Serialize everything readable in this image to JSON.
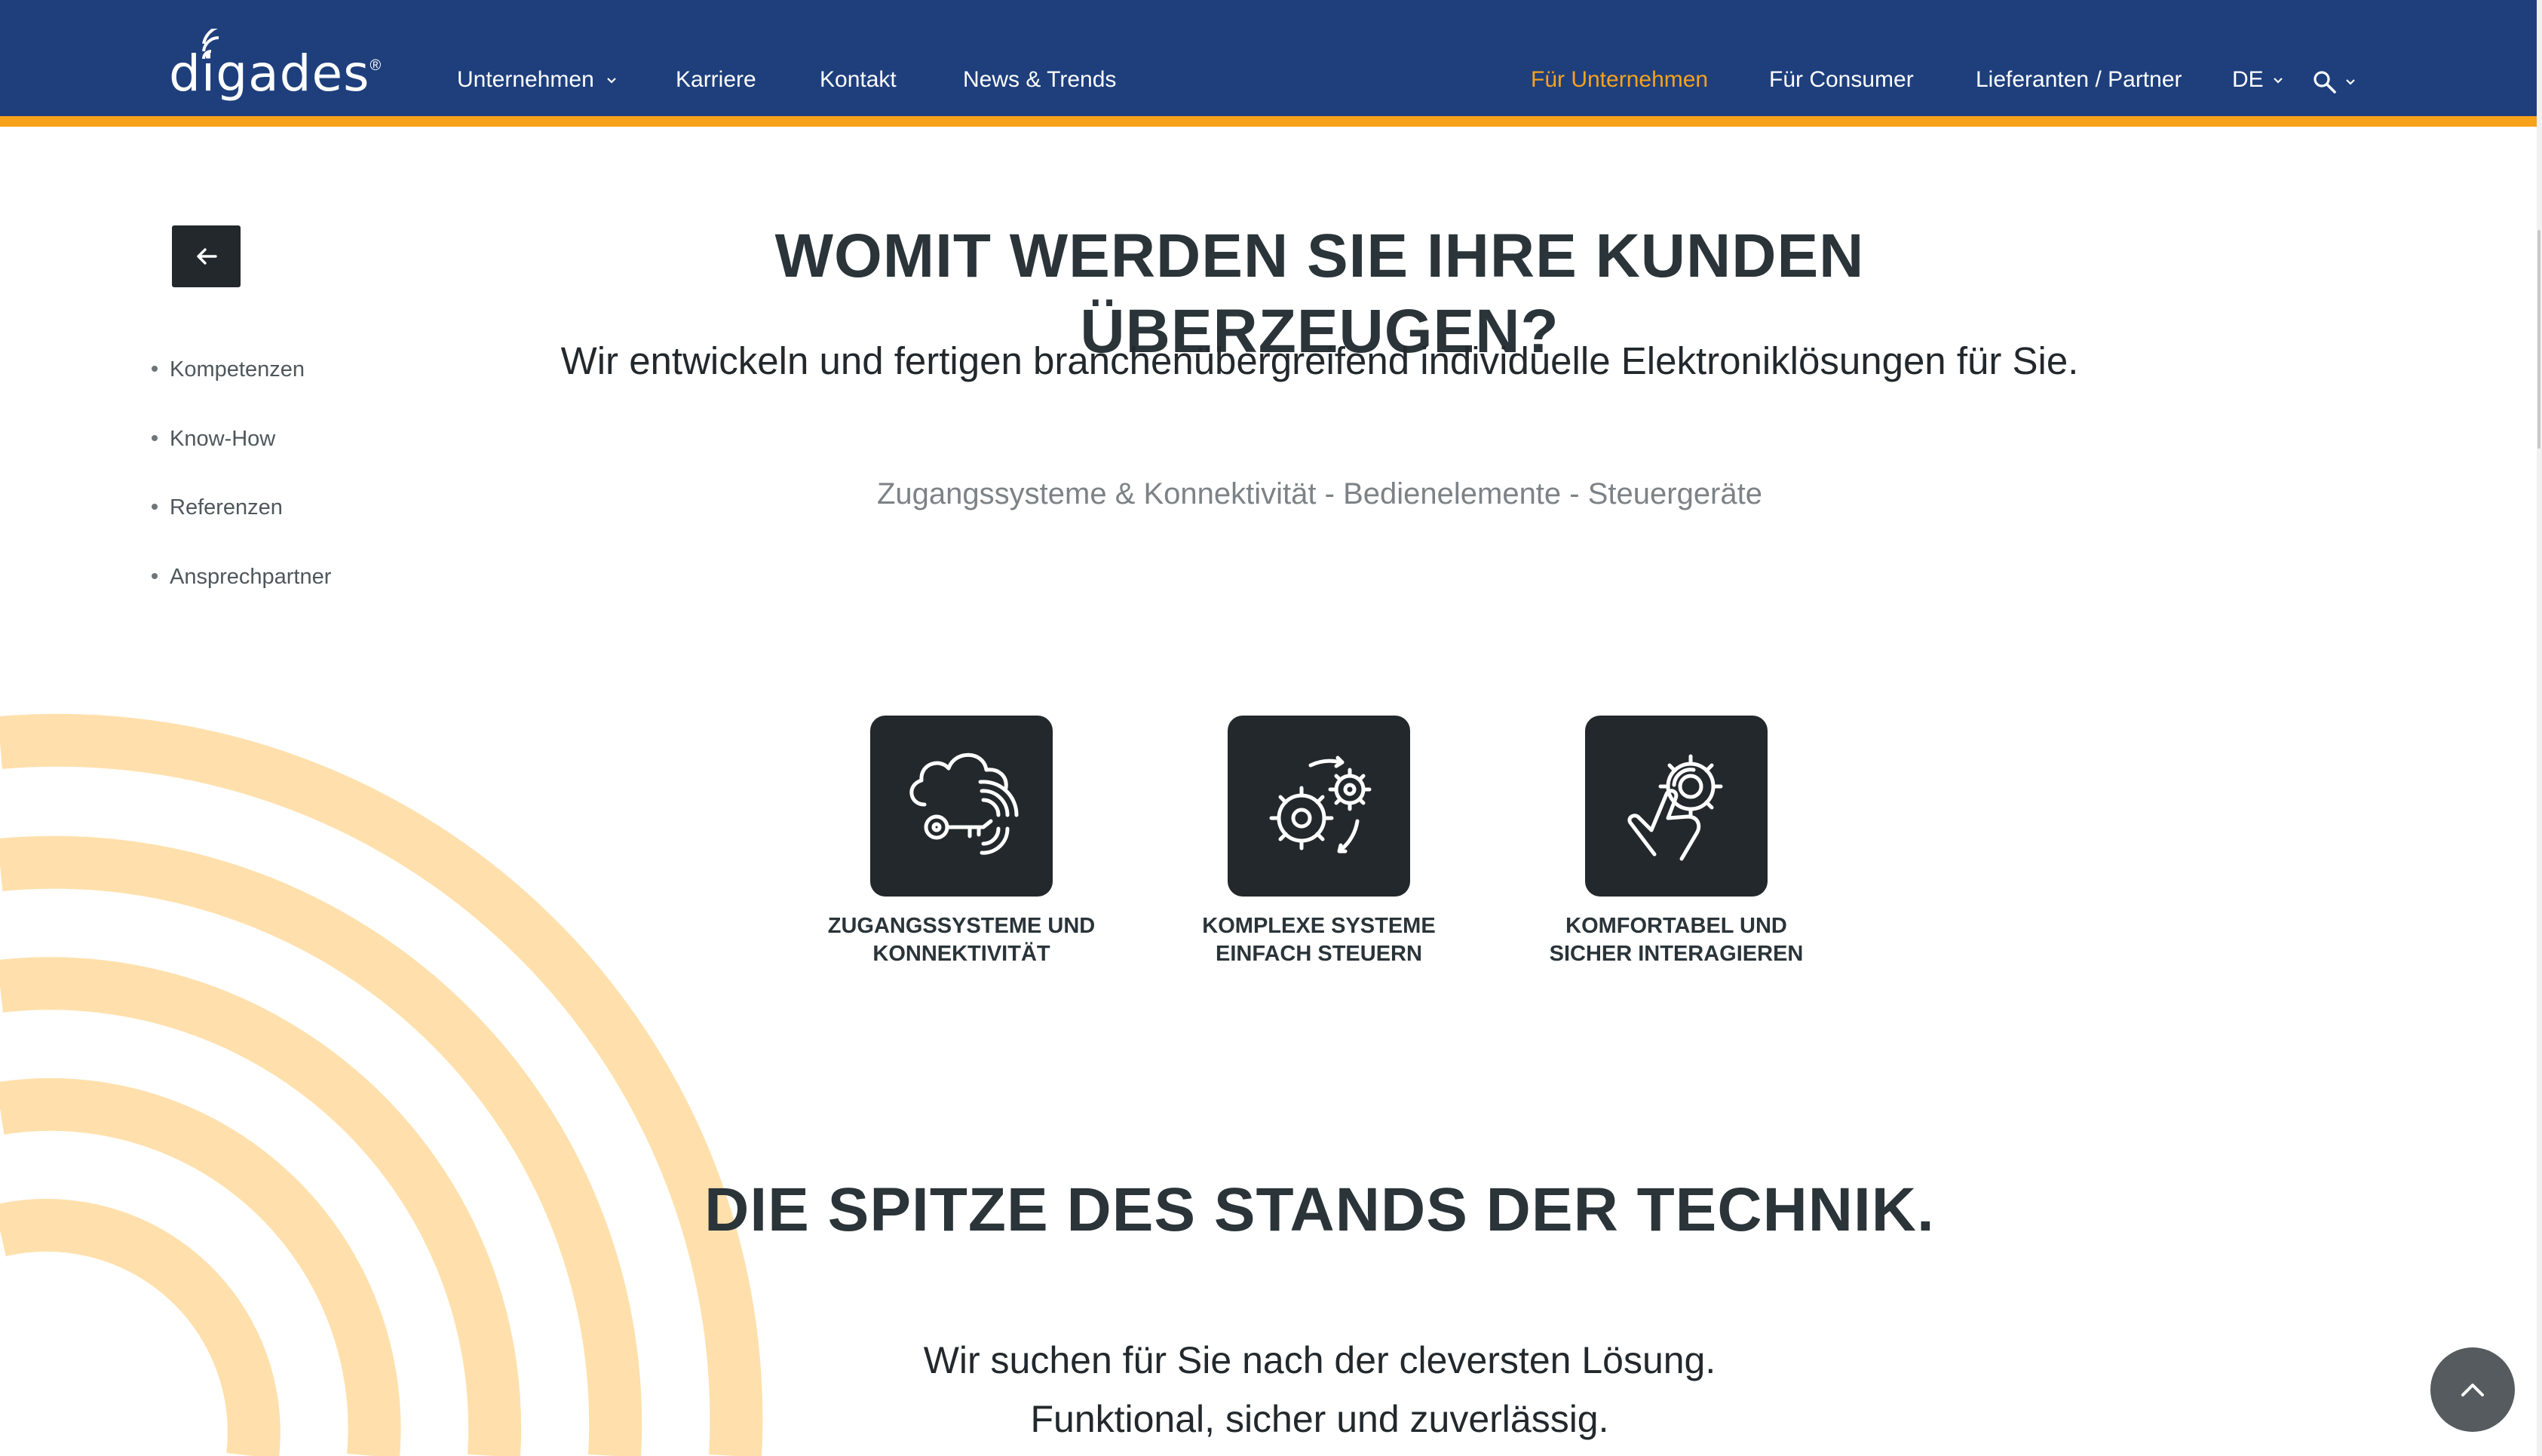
{
  "header": {
    "logo_text": "digades",
    "logo_mark": "®",
    "nav_left": [
      {
        "label": "Unternehmen",
        "has_dropdown": true
      },
      {
        "label": "Karriere"
      },
      {
        "label": "Kontakt"
      },
      {
        "label": "News & Trends"
      }
    ],
    "nav_right": [
      {
        "label": "Für Unternehmen",
        "active": true
      },
      {
        "label": "Für Consumer"
      },
      {
        "label": "Lieferanten / Partner"
      }
    ],
    "language": "DE",
    "search_icon": "search-icon",
    "colors": {
      "background": "#1e3f7c",
      "accent": "#f7a21b"
    }
  },
  "sidebar": {
    "back_icon": "arrow-left-icon",
    "items": [
      {
        "label": "Kompetenzen"
      },
      {
        "label": "Know-How"
      },
      {
        "label": "Referenzen"
      },
      {
        "label": "Ansprechpartner"
      }
    ]
  },
  "intro": {
    "heading": "WOMIT WERDEN SIE IHRE KUNDEN ÜBERZEUGEN?",
    "lead": "Wir entwickeln und fertigen branchenübergreifend individuelle Elektroniklösungen für Sie.",
    "subline": "Zugangssysteme & Konnektivität - Bedienelemente - Steuergeräte"
  },
  "features": [
    {
      "icon": "cloud-key-icon",
      "line1": "ZUGANGSSYSTEME UND",
      "line2": "KONNEKTIVITÄT"
    },
    {
      "icon": "gears-icon",
      "line1": "KOMPLEXE SYSTEME",
      "line2": "EINFACH STEUERN"
    },
    {
      "icon": "touch-gear-icon",
      "line1": "KOMFORTABEL UND",
      "line2": "SICHER INTERAGIEREN"
    }
  ],
  "technik": {
    "heading": "DIE SPITZE DES STANDS DER TECHNIK.",
    "line1": "Wir suchen für Sie nach der cleversten Lösung.",
    "line2": "Funktional, sicher und zuverlässig."
  },
  "scroll_top_icon": "chevron-up-icon",
  "decoration_color": "#ffe0ac"
}
